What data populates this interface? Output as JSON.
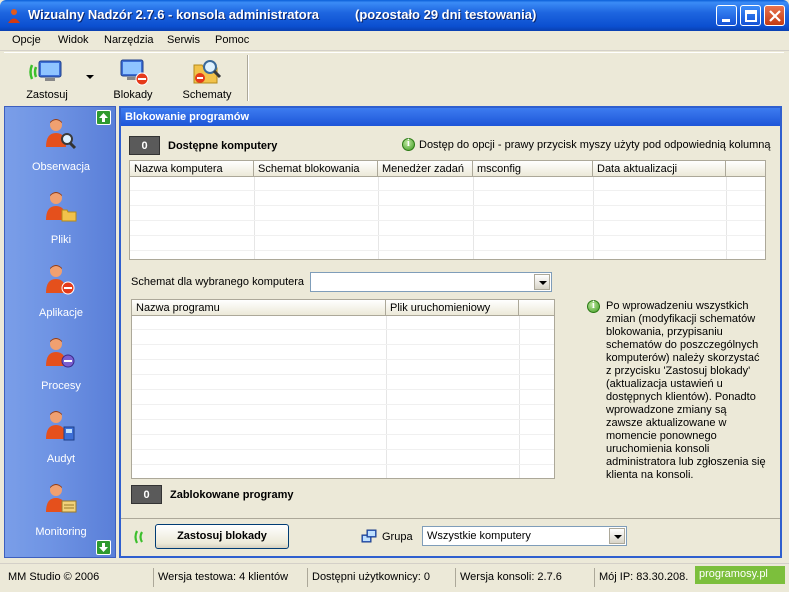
{
  "window": {
    "title": "Wizualny Nadzór 2.7.6 - konsola administratora",
    "trial": "(pozostało 29 dni testowania)"
  },
  "menu": [
    "Opcje",
    "Widok",
    "Narzędzia",
    "Serwis",
    "Pomoc"
  ],
  "toolbar": {
    "apply": "Zastosuj",
    "blocks": "Blokady",
    "schemes": "Schematy"
  },
  "sidebar": {
    "items": [
      "Obserwacja",
      "Pliki",
      "Aplikacje",
      "Procesy",
      "Audyt",
      "Monitoring"
    ]
  },
  "main": {
    "header": "Blokowanie programów",
    "available_count": "0",
    "available_title": "Dostępne komputery",
    "hint": "Dostęp do opcji - prawy przycisk myszy użyty pod odpowiednią kolumną",
    "computers_columns": [
      "Nazwa komputera",
      "Schemat blokowania",
      "Menedżer zadań",
      "msconfig",
      "Data aktualizacji"
    ],
    "scheme_label": "Schemat dla wybranego komputera",
    "scheme_value": "",
    "programs_columns": [
      "Nazwa programu",
      "Plik uruchomieniowy"
    ],
    "info": "Po wprowadzeniu wszystkich zmian (modyfikacji schematów blokowania, przypisaniu schematów do poszczególnych komputerów) należy skorzystać z przycisku 'Zastosuj blokady' (aktualizacja ustawień u dostępnych klientów). Ponadto wprowadzone zmiany są zawsze aktualizowane w momencie ponownego uruchomienia konsoli administratora lub zgłoszenia się klienta na konsoli.",
    "blocked_count": "0",
    "blocked_title": "Zablokowane programy",
    "apply_button": "Zastosuj blokady",
    "group_label": "Grupa",
    "group_value": "Wszystkie komputery"
  },
  "status": {
    "copyright": "MM Studio © 2006",
    "version_test": "Wersja testowa: 4 klientów",
    "users": "Dostępni użytkownicy:  0",
    "console": "Wersja konsoli:  2.7.6",
    "ip": "Mój IP:  83.30.208.",
    "watermark": "programosy.pl"
  },
  "colors": {
    "title_bar": "#1e66e0",
    "sidebar": "#6f94e4",
    "panel_border": "#2f5fcf",
    "accent_green": "#3c9a1e"
  }
}
